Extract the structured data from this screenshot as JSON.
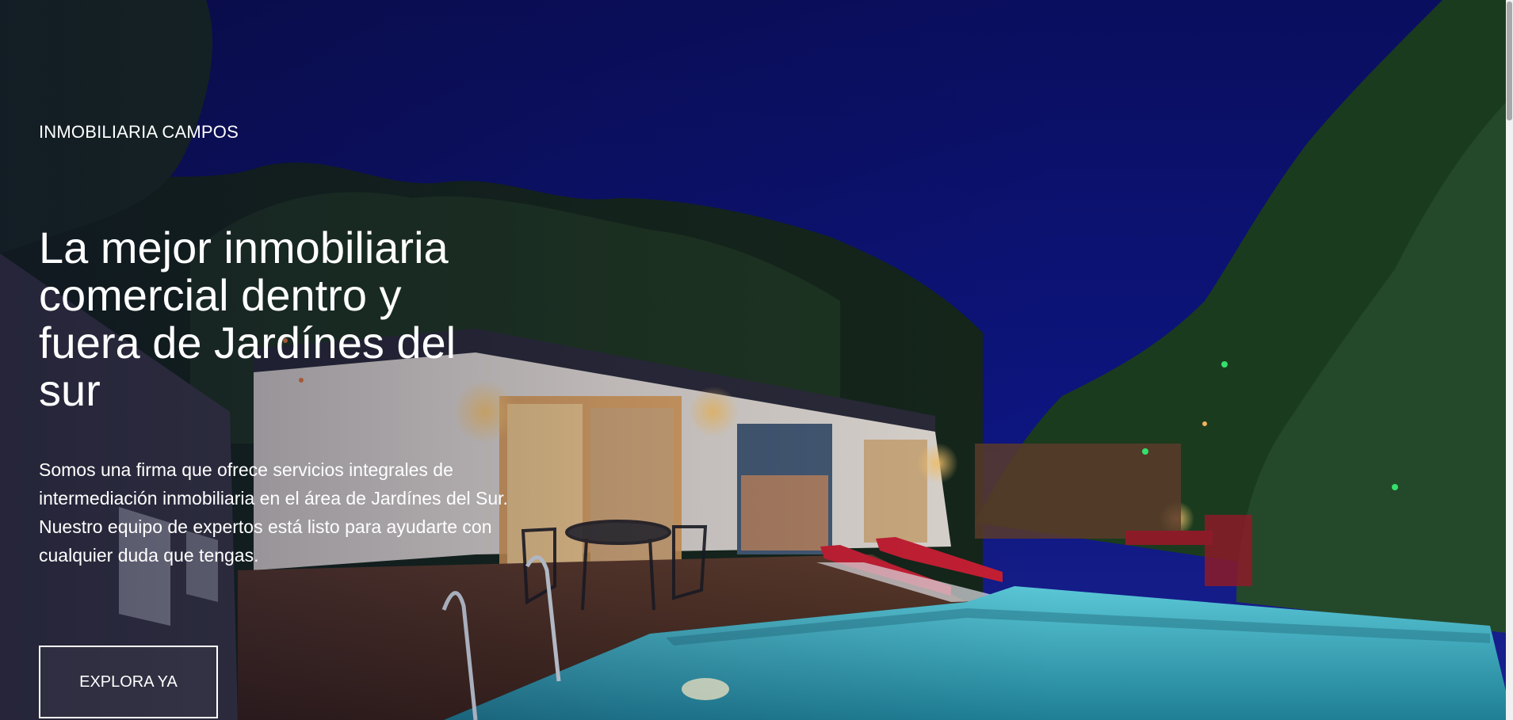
{
  "brand": {
    "name": "INMOBILIARIA CAMPOS"
  },
  "hero": {
    "headline": "La mejor inmobiliaria comercial dentro y fuera de Jardínes del sur",
    "description": "Somos una firma que ofrece servicios integrales de intermediación inmobiliaria en el área de Jardínes del Sur. Nuestro equipo de expertos está listo para ayudarte con cualquier duda que tengas.",
    "cta_label": "EXPLORA YA"
  },
  "background": {
    "icon": "house-with-pool-at-night-photo",
    "colors": {
      "sky": "#0d1273",
      "pool": "#3fb6c7",
      "foliage": "#1c3a1c",
      "warm_light": "#f2b35a"
    }
  }
}
